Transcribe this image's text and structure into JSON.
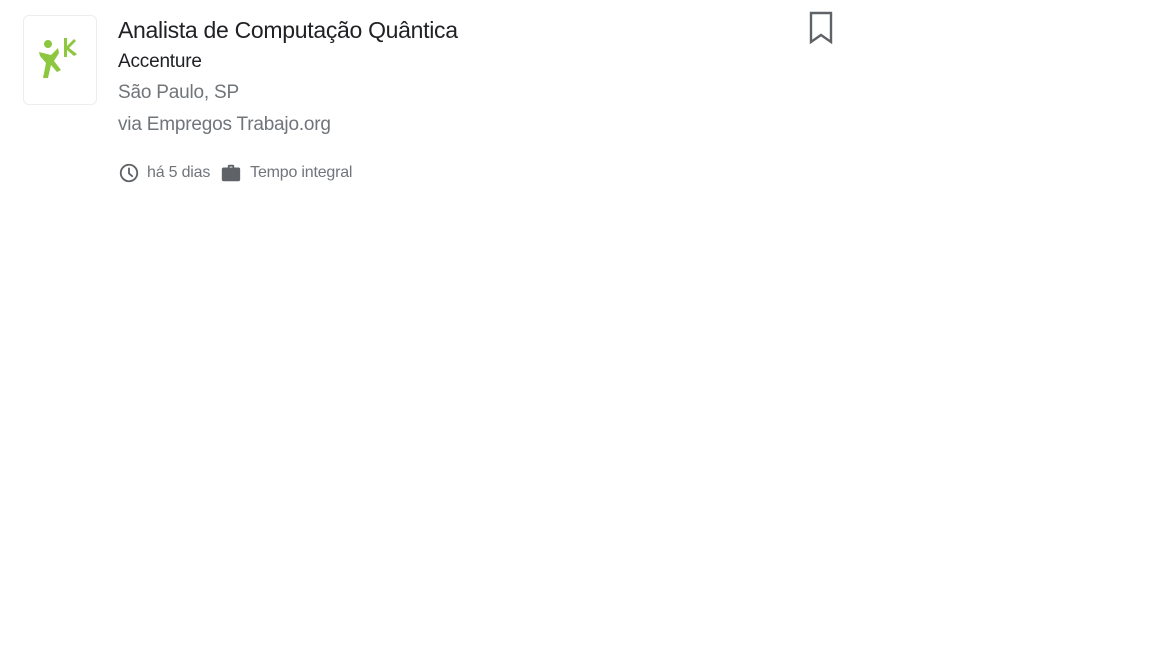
{
  "job": {
    "title": "Analista de Computação Quântica",
    "company": "Accenture",
    "location": "São Paulo, SP",
    "source": "via Empregos Trabajo.org",
    "posted": "há 5 dias",
    "type": "Tempo integral",
    "logo_icon": "company-logo-icon",
    "logo_color": "#8dc63f"
  },
  "icons": {
    "posted": "clock-icon",
    "type": "briefcase-icon",
    "save": "bookmark-icon"
  },
  "colors": {
    "title_text": "#202124",
    "secondary_text": "#70757a",
    "icon_gray": "#5f6368"
  }
}
